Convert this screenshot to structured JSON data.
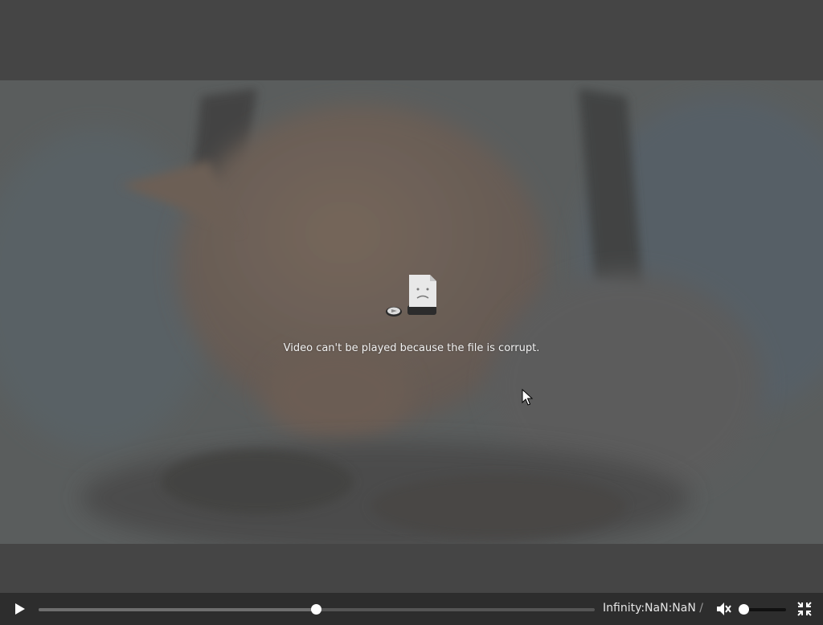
{
  "player": {
    "error_message": "Video can't be played because the file is corrupt.",
    "controls": {
      "play_icon": "play-icon",
      "time_current": "Infinity:NaN:NaN",
      "time_separator": "/",
      "mute_icon": "speaker-muted-icon",
      "fullscreen_icon": "exit-fullscreen-icon",
      "progress": 0.5,
      "volume": 0.0
    },
    "colors": {
      "control_bar": "#2d2d2d",
      "letterbox": "#454545",
      "thumb": "#ffffff"
    }
  }
}
